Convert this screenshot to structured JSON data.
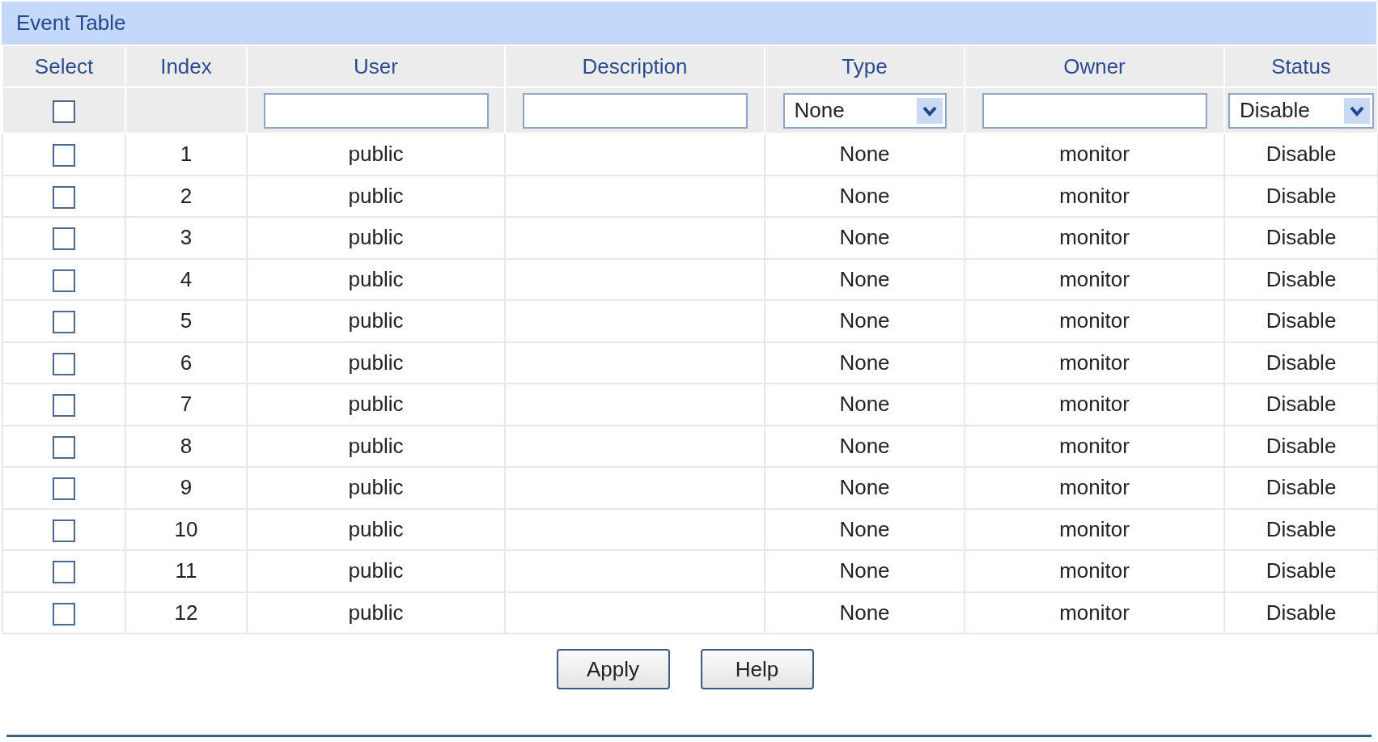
{
  "title": "Event Table",
  "columns": [
    "Select",
    "Index",
    "User",
    "Description",
    "Type",
    "Owner",
    "Status"
  ],
  "filter": {
    "checked": false,
    "type": "None",
    "status": "Disable"
  },
  "rows": [
    {
      "checked": false,
      "index": "1",
      "user": "public",
      "type": "None",
      "owner": "monitor",
      "status": "Disable"
    },
    {
      "checked": false,
      "index": "2",
      "user": "public",
      "type": "None",
      "owner": "monitor",
      "status": "Disable"
    },
    {
      "checked": false,
      "index": "3",
      "user": "public",
      "type": "None",
      "owner": "monitor",
      "status": "Disable"
    },
    {
      "checked": false,
      "index": "4",
      "user": "public",
      "type": "None",
      "owner": "monitor",
      "status": "Disable"
    },
    {
      "checked": false,
      "index": "5",
      "user": "public",
      "type": "None",
      "owner": "monitor",
      "status": "Disable"
    },
    {
      "checked": false,
      "index": "6",
      "user": "public",
      "type": "None",
      "owner": "monitor",
      "status": "Disable"
    },
    {
      "checked": false,
      "index": "7",
      "user": "public",
      "type": "None",
      "owner": "monitor",
      "status": "Disable"
    },
    {
      "checked": false,
      "index": "8",
      "user": "public",
      "type": "None",
      "owner": "monitor",
      "status": "Disable"
    },
    {
      "checked": false,
      "index": "9",
      "user": "public",
      "type": "None",
      "owner": "monitor",
      "status": "Disable"
    },
    {
      "checked": false,
      "index": "10",
      "user": "public",
      "type": "None",
      "owner": "monitor",
      "status": "Disable"
    },
    {
      "checked": false,
      "index": "11",
      "user": "public",
      "type": "None",
      "owner": "monitor",
      "status": "Disable"
    },
    {
      "checked": false,
      "index": "12",
      "user": "public",
      "type": "None",
      "owner": "monitor",
      "status": "Disable"
    }
  ],
  "buttons": [
    "Apply",
    "Help"
  ]
}
